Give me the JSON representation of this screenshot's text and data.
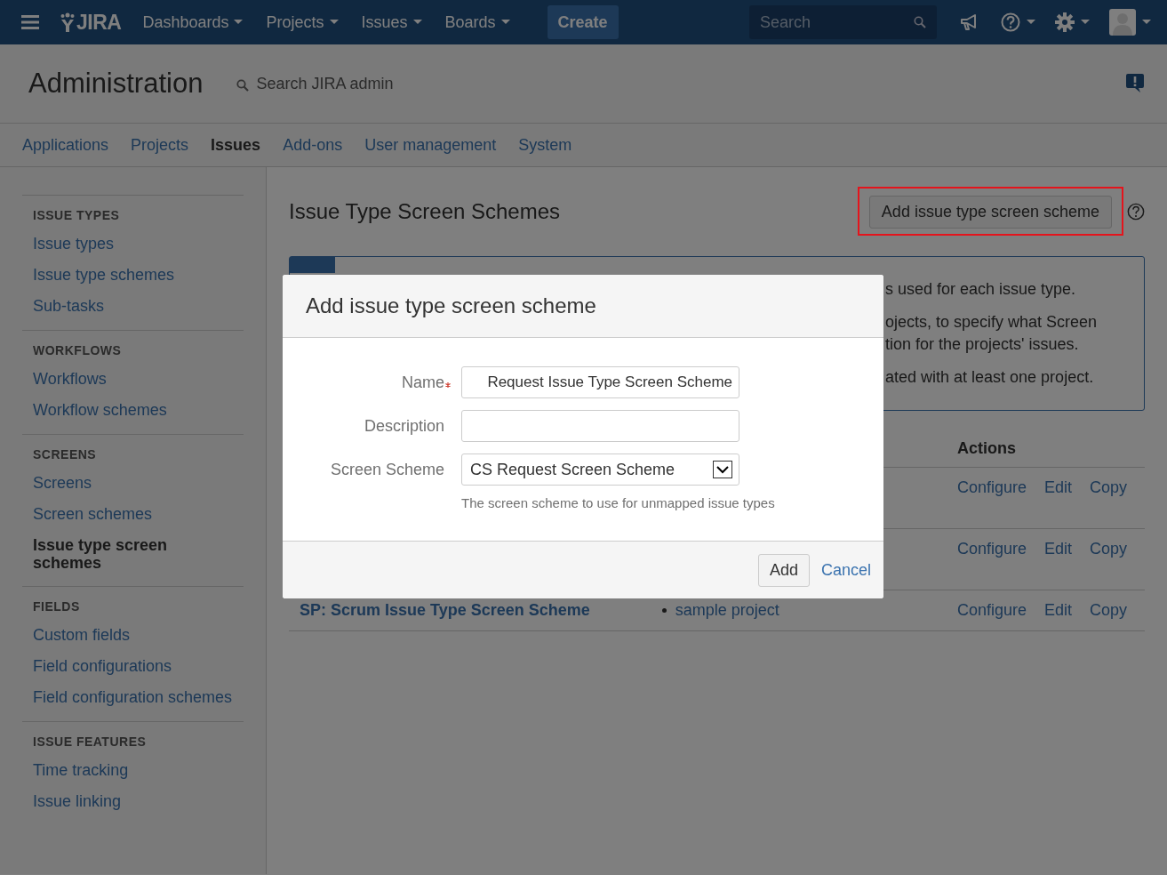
{
  "header": {
    "logo": "JIRA",
    "menus": [
      {
        "label": "Dashboards"
      },
      {
        "label": "Projects"
      },
      {
        "label": "Issues"
      },
      {
        "label": "Boards"
      }
    ],
    "create": "Create",
    "search": {
      "placeholder": "Search"
    }
  },
  "admin": {
    "title": "Administration",
    "search": {
      "placeholder": "Search JIRA admin"
    }
  },
  "tabs": [
    {
      "label": "Applications",
      "selected": false
    },
    {
      "label": "Projects",
      "selected": false
    },
    {
      "label": "Issues",
      "selected": true
    },
    {
      "label": "Add-ons",
      "selected": false
    },
    {
      "label": "User management",
      "selected": false
    },
    {
      "label": "System",
      "selected": false
    }
  ],
  "sidebar": [
    {
      "heading": "ISSUE TYPES",
      "items": [
        {
          "label": "Issue types",
          "selected": false
        },
        {
          "label": "Issue type schemes",
          "selected": false
        },
        {
          "label": "Sub-tasks",
          "selected": false
        }
      ]
    },
    {
      "heading": "WORKFLOWS",
      "items": [
        {
          "label": "Workflows",
          "selected": false
        },
        {
          "label": "Workflow schemes",
          "selected": false
        }
      ]
    },
    {
      "heading": "SCREENS",
      "items": [
        {
          "label": "Screens",
          "selected": false
        },
        {
          "label": "Screen schemes",
          "selected": false
        },
        {
          "label": "Issue type screen schemes",
          "selected": true
        }
      ]
    },
    {
      "heading": "FIELDS",
      "items": [
        {
          "label": "Custom fields",
          "selected": false
        },
        {
          "label": "Field configurations",
          "selected": false
        },
        {
          "label": "Field configuration schemes",
          "selected": false
        }
      ]
    },
    {
      "heading": "ISSUE FEATURES",
      "items": [
        {
          "label": "Time tracking",
          "selected": false
        },
        {
          "label": "Issue linking",
          "selected": false
        }
      ]
    }
  ],
  "page": {
    "title": "Issue Type Screen Schemes",
    "add_button": "Add issue type screen scheme",
    "highlighted": true,
    "info": [
      "s used for each issue type.",
      "ojects, to specify what Screen",
      "tion for the projects' issues.",
      "ated with at least one project."
    ],
    "table": {
      "columns": [
        "Actions"
      ],
      "rows": [
        {
          "actions": [
            "Configure",
            "Edit",
            "Copy"
          ]
        },
        {
          "actions": [
            "Configure",
            "Edit",
            "Copy"
          ]
        },
        {
          "name": "SP: Scrum Issue Type Screen Scheme",
          "project": "sample project",
          "actions": [
            "Configure",
            "Edit",
            "Copy"
          ]
        }
      ]
    }
  },
  "dialog": {
    "title": "Add issue type screen scheme",
    "fields": [
      {
        "kind": "text",
        "label": "Name",
        "required": true,
        "value": "Request Issue Type Screen Scheme"
      },
      {
        "kind": "text",
        "label": "Description",
        "required": false
      },
      {
        "kind": "select",
        "label": "Screen Scheme",
        "required": false,
        "value": "CS Request Screen Scheme",
        "hint": "The screen scheme to use for unmapped issue types"
      }
    ],
    "add": "Add",
    "cancel": "Cancel"
  }
}
